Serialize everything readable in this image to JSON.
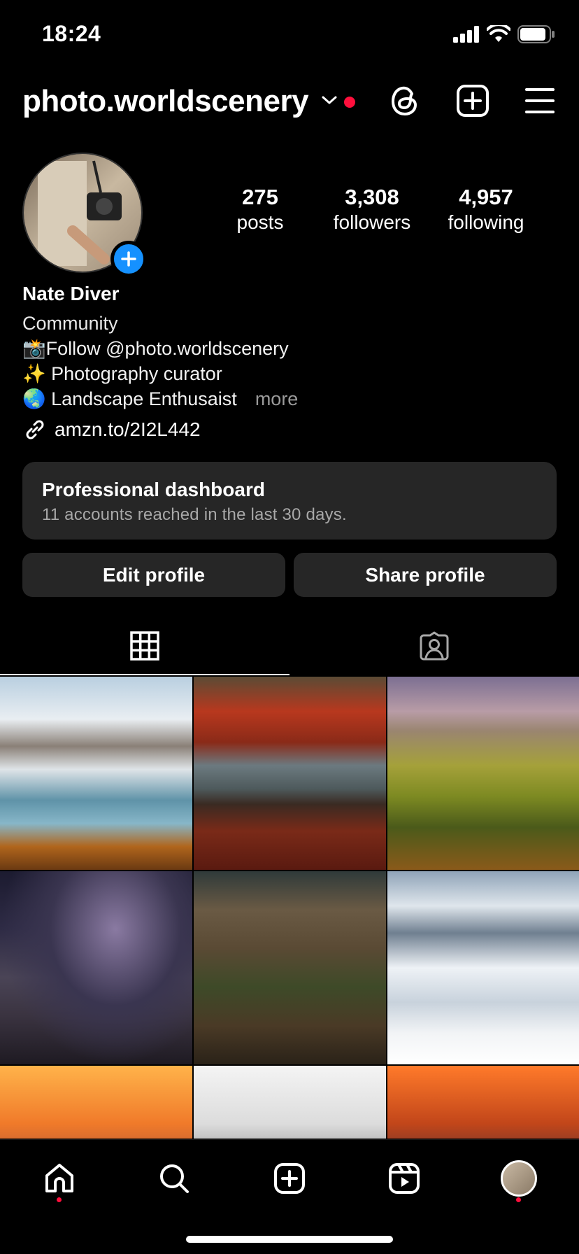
{
  "status_bar": {
    "time": "18:24"
  },
  "header": {
    "username": "photo.worldscenery"
  },
  "profile": {
    "stats": [
      {
        "value": "275",
        "label": "posts"
      },
      {
        "value": "3,308",
        "label": "followers"
      },
      {
        "value": "4,957",
        "label": "following"
      }
    ],
    "name": "Nate Diver",
    "category": "Community",
    "bio_lines": [
      "📸Follow @photo.worldscenery",
      "✨ Photography curator",
      "🌏 Landscape Enthusaist"
    ],
    "more_label": "more",
    "link": "amzn.to/2I2L442"
  },
  "dashboard": {
    "title": "Professional dashboard",
    "subtitle": "11 accounts reached in the last 30 days."
  },
  "buttons": {
    "edit": "Edit profile",
    "share": "Share profile"
  },
  "tabs": [
    {
      "icon": "grid-icon",
      "selected": true
    },
    {
      "icon": "tagged-icon",
      "selected": false
    }
  ],
  "grid": {
    "post_count_visible": 9
  },
  "bottom_nav": [
    "home-icon",
    "search-icon",
    "create-icon",
    "reels-icon",
    "profile-avatar"
  ],
  "colors": {
    "accent": "#1591ff",
    "notification": "#ff0f3c",
    "card": "#262626"
  }
}
